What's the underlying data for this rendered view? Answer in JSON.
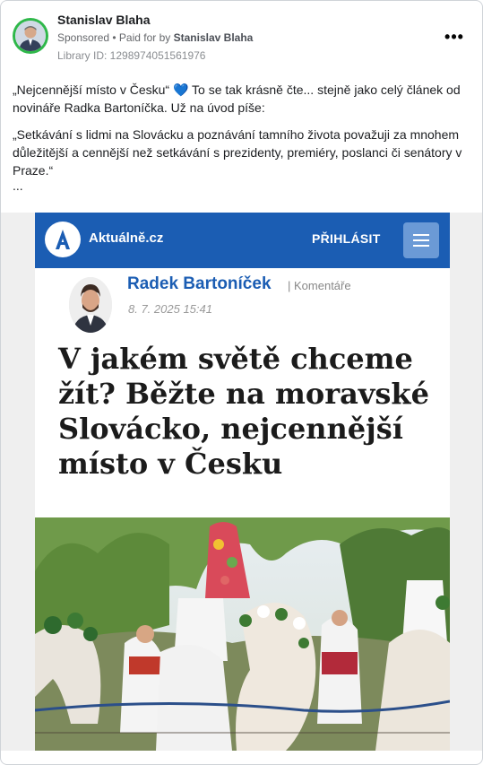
{
  "post": {
    "author": "Stanislav Blaha",
    "sponsored": "Sponsored",
    "paid_for_prefix": " • Paid for by ",
    "paid_for_by": "Stanislav Blaha",
    "library_id": "Library ID: 1298974051561976",
    "more_icon": "more-options-icon",
    "text_line1_a": "„Nejcennější místo v Česku“ ",
    "text_line1_heart": "💙",
    "text_line1_b": " To se tak krásně čte... stejně jako celý článek od novináře Radka Bartoníčka. Už na úvod píše:",
    "text_quote": "„Setkávání s lidmi na Slovácku a poznávání tamního života považuji za mnohem důležitější a cennější než setkávání s prezidenty, premiéry, poslanci či senátory v Praze.“",
    "text_ellipsis": "..."
  },
  "article": {
    "site_name": "Aktuálně.cz",
    "login_label": "PŘIHLÁSIT",
    "menu_icon": "hamburger-menu-icon",
    "author_name": "Radek Bartoníček",
    "section_separator": "|",
    "section": " Komentáře",
    "date": "8. 7. 2025 15:41",
    "headline": "V jakém světě chceme žít? Běžte na moravské Slovácko, nejcennější místo v Česku"
  },
  "colors": {
    "brand_blue": "#1b5db3",
    "avatar_ring": "#2fb84a",
    "menu_button": "#6b9ad6"
  }
}
